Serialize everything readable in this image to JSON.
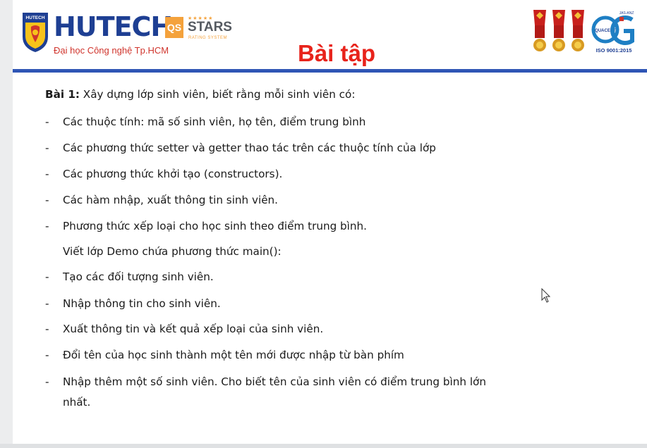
{
  "header": {
    "brand": "HUTECH",
    "tagline": "Đại học Công nghệ Tp.HCM",
    "qs_mark": "QS",
    "qs_title": "STARS",
    "qs_subtitle": "RATING SYSTEM",
    "shield_label": "HUTECH",
    "cert_label": "ISO 9001:2015",
    "cert_name": "QUACERT",
    "cert_top": "JAS-ANZ",
    "slide_title": "Bài tập"
  },
  "exercise": {
    "label": "Bài 1:",
    "intro": " Xây dựng lớp sinh viên, biết rằng mỗi sinh viên có:",
    "items_a": [
      "Các thuộc tính: mã số sinh viên, họ tên, điểm trung bình",
      "Các phương thức setter và getter thao tác trên các thuộc tính của lớp",
      "Các phương thức khởi tạo (constructors).",
      "Các hàm nhập, xuất thông tin sinh viên.",
      "Phương thức xếp loại cho học sinh theo điểm trung bình."
    ],
    "demo_heading": "Viết lớp Demo chứa phương thức main():",
    "items_b": [
      "Tạo các đối tượng sinh viên.",
      "Nhập thông tin cho sinh viên.",
      "Xuất thông tin và kết quả xếp loại của sinh viên.",
      "Đổi tên của học sinh thành một tên mới được nhập từ bàn phím",
      "Nhập thêm một số sinh viên. Cho biết tên của sinh viên có điểm trung bình lớn"
    ],
    "items_b_wrap": "nhất.",
    "bullet": "-"
  }
}
